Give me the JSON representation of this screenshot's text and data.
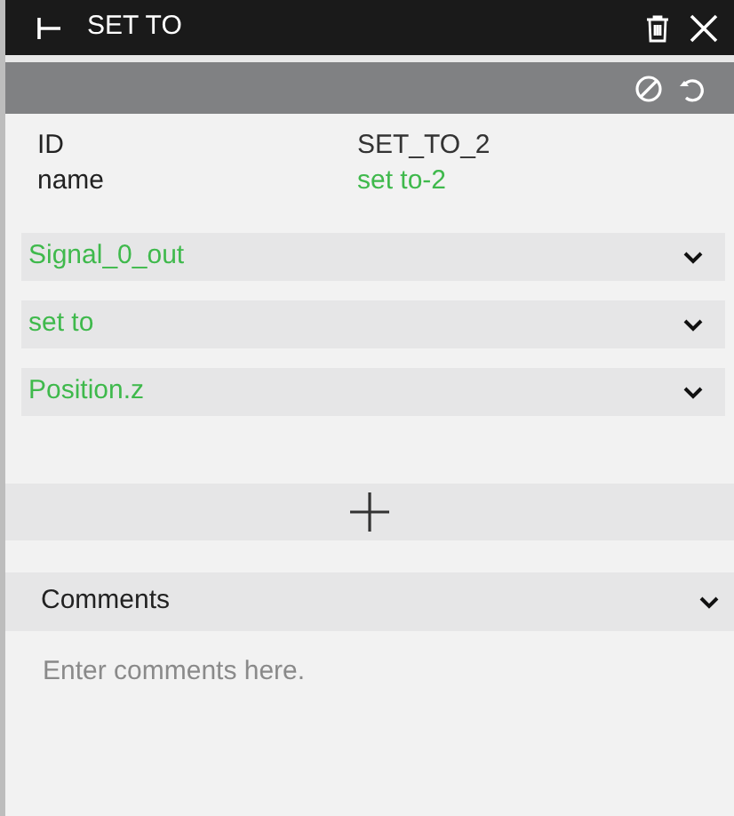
{
  "header": {
    "title": "SET TO"
  },
  "properties": [
    {
      "label": "ID",
      "value": "SET_TO_2",
      "editable": false
    },
    {
      "label": "name",
      "value": "set to-2",
      "editable": true
    }
  ],
  "dropdowns": [
    {
      "value": "Signal_0_out"
    },
    {
      "value": "set to"
    },
    {
      "value": "Position.z"
    }
  ],
  "comments": {
    "title": "Comments",
    "placeholder": "Enter comments here."
  }
}
